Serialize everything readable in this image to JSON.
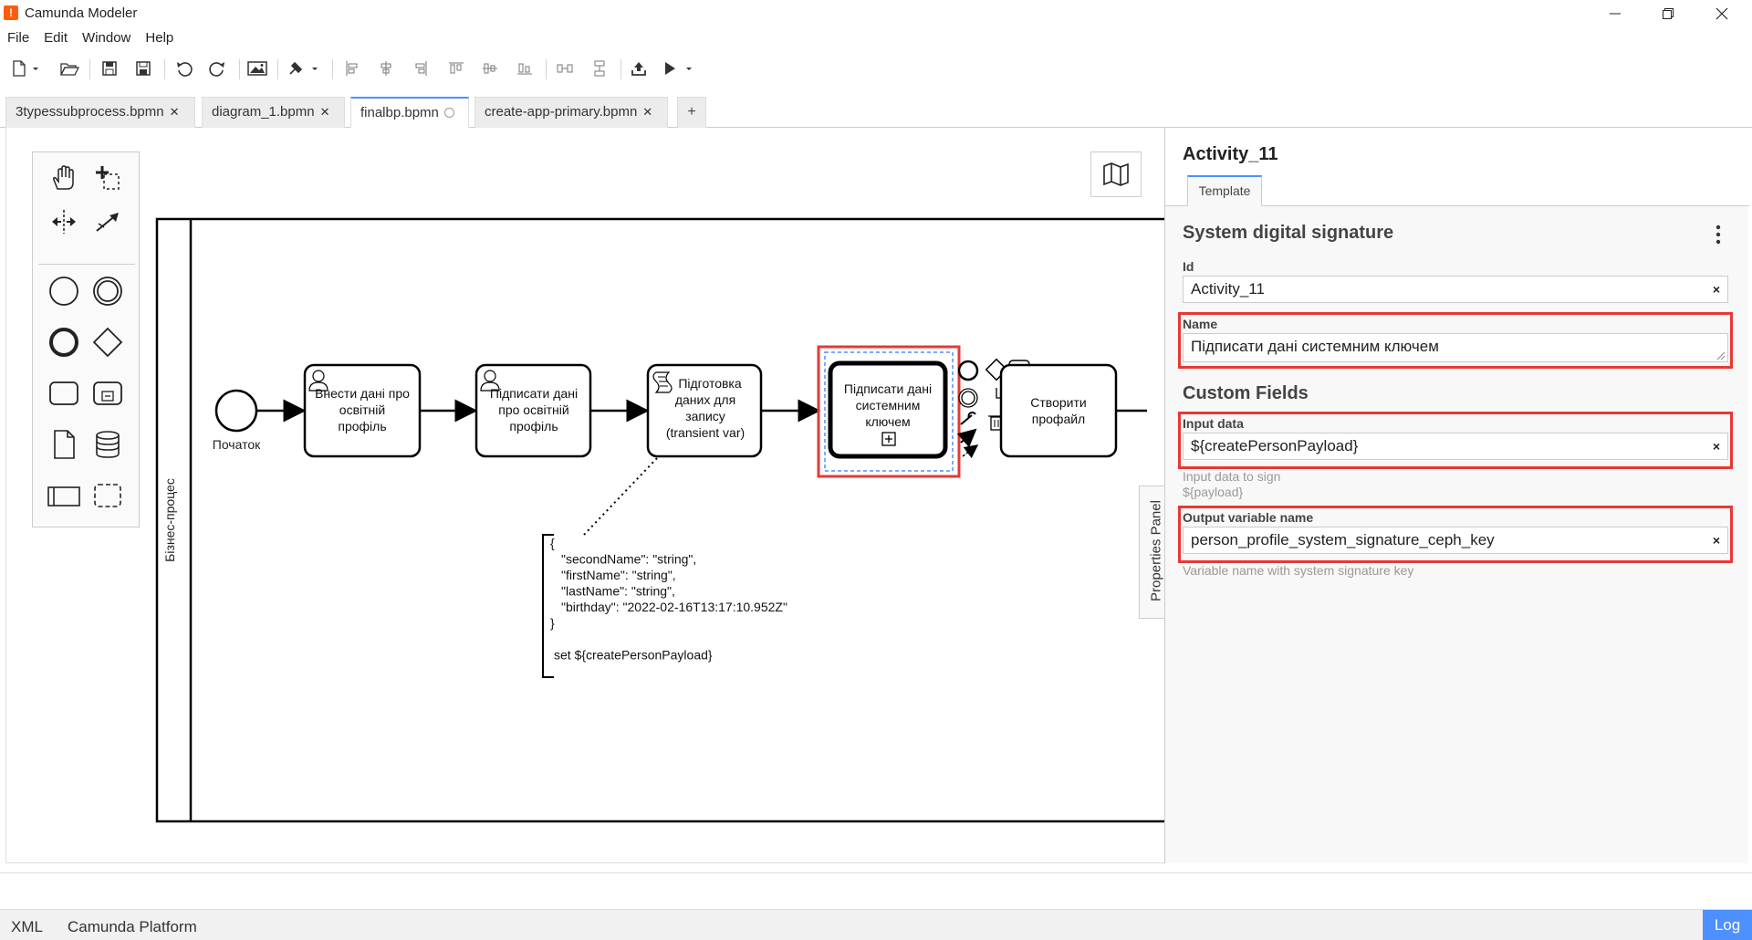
{
  "window": {
    "title": "Camunda Modeler",
    "logo_glyph": "!"
  },
  "menu": [
    "File",
    "Edit",
    "Window",
    "Help"
  ],
  "tabs": [
    {
      "label": "3typessubprocess.bpmn",
      "state": "closable"
    },
    {
      "label": "diagram_1.bpmn",
      "state": "closable"
    },
    {
      "label": "finalbp.bpmn",
      "state": "dirty",
      "active": true
    },
    {
      "label": "create-app-primary.bpmn",
      "state": "closable"
    }
  ],
  "tab_add": "+",
  "diagram": {
    "pool_label": "Бізнес-процес",
    "start_event_label": "Початок",
    "tasks": [
      "Внести дані про освітній профіль",
      "Підписати дані про освітній профіль",
      "Підготовка даних для запису (transient var)",
      "Підписати дані системним ключем",
      "Створити профайл"
    ],
    "annotation": {
      "lines": [
        "{",
        "\"secondName\": \"string\",",
        "\"firstName\": \"string\",",
        "\"lastName\": \"string\",",
        "\"birthday\": \"2022-02-16T13:17:10.952Z\"",
        "}",
        "",
        "set ${createPersonPayload}"
      ]
    }
  },
  "properties": {
    "toggle_label": "Properties Panel",
    "element_id": "Activity_11",
    "tab": "Template",
    "template_title": "System digital signature",
    "id_label": "Id",
    "id_value": "Activity_11",
    "name_label": "Name",
    "name_value": "Підписати дані системним ключем",
    "custom_fields_title": "Custom Fields",
    "input_label": "Input data",
    "input_value": "${createPersonPayload}",
    "input_desc": "Input data to sign ${payload}",
    "output_label": "Output variable name",
    "output_value": "person_profile_system_signature_ceph_key",
    "output_desc": "Variable name with system signature key",
    "clear_glyph": "×",
    "highlight_color": "#e53935"
  },
  "status": {
    "xml": "XML",
    "platform": "Camunda Platform",
    "log": "Log"
  }
}
